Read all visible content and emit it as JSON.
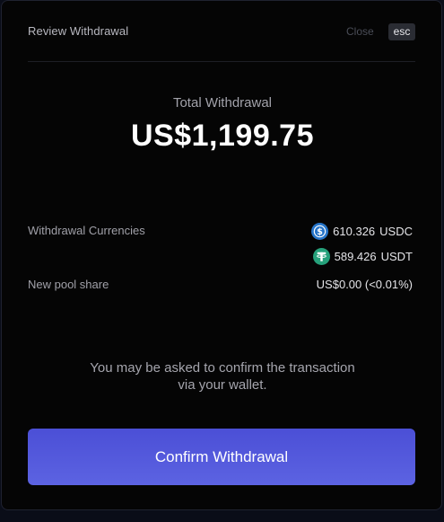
{
  "header": {
    "title": "Review Withdrawal",
    "close_label": "Close",
    "esc_label": "esc"
  },
  "summary": {
    "label": "Total Withdrawal",
    "amount": "US$1,199.75"
  },
  "details": {
    "currencies_label": "Withdrawal Currencies",
    "currencies": [
      {
        "icon": "usdc-icon",
        "amount": "610.326",
        "symbol": "USDC",
        "color": "#2775ca"
      },
      {
        "icon": "usdt-icon",
        "amount": "589.426",
        "symbol": "USDT",
        "color": "#26a17b"
      }
    ],
    "pool_share_label": "New pool share",
    "pool_share_value": "US$0.00 (<0.01%)"
  },
  "notice": {
    "line1": "You may be asked to confirm the transaction",
    "line2": "via your wallet."
  },
  "actions": {
    "confirm_label": "Confirm Withdrawal"
  },
  "colors": {
    "accent": "#5258dc",
    "background": "#050505"
  }
}
